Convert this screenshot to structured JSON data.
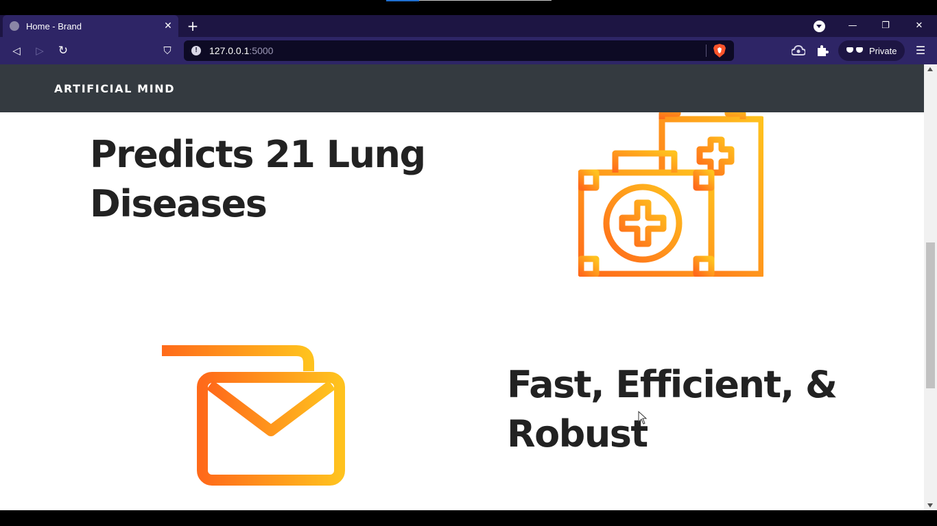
{
  "browser": {
    "tab": {
      "title": "Home - Brand",
      "close": "✕"
    },
    "new_tab": "+",
    "window_controls": {
      "minimize": "—",
      "restore": "❐",
      "close": "✕"
    },
    "toolbar": {
      "back": "◁",
      "forward": "▷",
      "reload": "↻",
      "bookmark": "⛉",
      "url_host": "127.0.0.1",
      "url_port": ":5000",
      "private_label": "Private",
      "menu": "☰"
    },
    "icons": [
      "globe-icon",
      "close-icon",
      "plus-icon",
      "chevron-down-icon",
      "back-icon",
      "forward-icon",
      "reload-icon",
      "bookmark-icon",
      "info-icon",
      "brave-shield-icon",
      "vpn-icon",
      "extensions-icon",
      "private-glasses-icon",
      "menu-icon"
    ]
  },
  "page": {
    "brand": "ARTIFICIAL MIND",
    "features": [
      {
        "heading": "Predicts 21 Lung Diseases",
        "icon": "medical-kit-icon"
      },
      {
        "heading": "Fast, Efficient, & Robust",
        "icon": "fast-mail-icon"
      }
    ]
  },
  "colors": {
    "tabbar": "#1d1543",
    "toolbar": "#2e2566",
    "navbar": "#343a40",
    "icon_gradient_start": "#ff6a1a",
    "icon_gradient_end": "#ffc21e",
    "heading": "#222222"
  }
}
